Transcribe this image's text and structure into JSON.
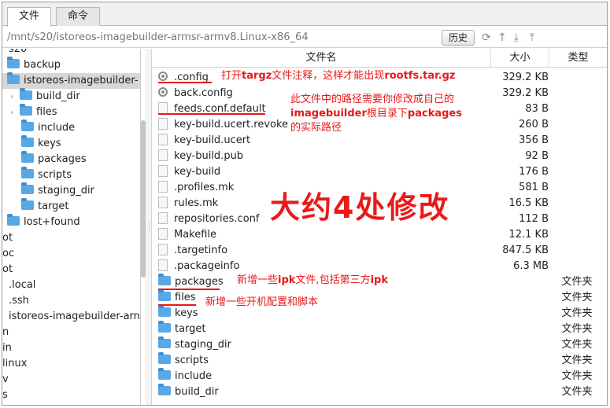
{
  "tabs": [
    {
      "label": "文件",
      "active": true
    },
    {
      "label": "命令",
      "active": false
    }
  ],
  "path": {
    "value": "/mnt/s20/istoreos-imagebuilder-armsr-armv8.Linux-x86_64",
    "history_label": "历史"
  },
  "toolbar_icons": [
    "refresh-icon",
    "up-icon",
    "download-icon",
    "upload-icon"
  ],
  "tree": [
    {
      "label": "s20",
      "kind": "text",
      "indent": 8,
      "cut": true
    },
    {
      "label": "backup",
      "kind": "folder",
      "indent": 6
    },
    {
      "label": "istoreos-imagebuilder-",
      "kind": "folder",
      "indent": 6,
      "selected": true
    },
    {
      "label": "build_dir",
      "kind": "folder",
      "indent": 10,
      "chevron": true
    },
    {
      "label": "files",
      "kind": "folder",
      "indent": 10,
      "chevron": true
    },
    {
      "label": "include",
      "kind": "folder",
      "indent": 24
    },
    {
      "label": "keys",
      "kind": "folder",
      "indent": 24
    },
    {
      "label": "packages",
      "kind": "folder",
      "indent": 24
    },
    {
      "label": "scripts",
      "kind": "folder",
      "indent": 24
    },
    {
      "label": "staging_dir",
      "kind": "folder",
      "indent": 24
    },
    {
      "label": "target",
      "kind": "folder",
      "indent": 24
    },
    {
      "label": "lost+found",
      "kind": "folder",
      "indent": 6
    },
    {
      "label": "ot",
      "kind": "text",
      "indent": 0
    },
    {
      "label": "oc",
      "kind": "text",
      "indent": 0
    },
    {
      "label": "ot",
      "kind": "text",
      "indent": 0
    },
    {
      "label": ".local",
      "kind": "text",
      "indent": 8
    },
    {
      "label": ".ssh",
      "kind": "text",
      "indent": 8
    },
    {
      "label": "istoreos-imagebuilder-arn",
      "kind": "text",
      "indent": 8
    },
    {
      "label": "n",
      "kind": "text",
      "indent": 0
    },
    {
      "label": "in",
      "kind": "text",
      "indent": 0
    },
    {
      "label": "linux",
      "kind": "text",
      "indent": 0
    },
    {
      "label": "v",
      "kind": "text",
      "indent": 0
    },
    {
      "label": "s",
      "kind": "text",
      "indent": 0
    }
  ],
  "columns": {
    "name": "文件名",
    "size": "大小",
    "type": "类型"
  },
  "files": [
    {
      "name": ".config",
      "size": "329.2 KB",
      "type": "",
      "icon": "gear"
    },
    {
      "name": "back.config",
      "size": "329.2 KB",
      "type": "",
      "icon": "gear"
    },
    {
      "name": "feeds.conf.default",
      "size": "83 B",
      "type": "",
      "icon": "doc"
    },
    {
      "name": "key-build.ucert.revoke",
      "size": "260 B",
      "type": "",
      "icon": "doc"
    },
    {
      "name": "key-build.ucert",
      "size": "356 B",
      "type": "",
      "icon": "doc"
    },
    {
      "name": "key-build.pub",
      "size": "92 B",
      "type": "",
      "icon": "doc"
    },
    {
      "name": "key-build",
      "size": "176 B",
      "type": "",
      "icon": "doc"
    },
    {
      "name": ".profiles.mk",
      "size": "581 B",
      "type": "",
      "icon": "doc"
    },
    {
      "name": "rules.mk",
      "size": "16.5 KB",
      "type": "",
      "icon": "doc"
    },
    {
      "name": "repositories.conf",
      "size": "112 B",
      "type": "",
      "icon": "doc"
    },
    {
      "name": "Makefile",
      "size": "12.1 KB",
      "type": "",
      "icon": "doc"
    },
    {
      "name": ".targetinfo",
      "size": "847.5 KB",
      "type": "",
      "icon": "doc"
    },
    {
      "name": ".packageinfo",
      "size": "6.3 MB",
      "type": "",
      "icon": "doc"
    },
    {
      "name": "packages",
      "size": "",
      "type": "文件夹",
      "icon": "folder"
    },
    {
      "name": "files",
      "size": "",
      "type": "文件夹",
      "icon": "folder"
    },
    {
      "name": "keys",
      "size": "",
      "type": "文件夹",
      "icon": "folder"
    },
    {
      "name": "target",
      "size": "",
      "type": "文件夹",
      "icon": "folder"
    },
    {
      "name": "staging_dir",
      "size": "",
      "type": "文件夹",
      "icon": "folder"
    },
    {
      "name": "scripts",
      "size": "",
      "type": "文件夹",
      "icon": "folder"
    },
    {
      "name": "include",
      "size": "",
      "type": "文件夹",
      "icon": "folder"
    },
    {
      "name": "build_dir",
      "size": "",
      "type": "文件夹",
      "icon": "folder"
    }
  ],
  "annotations": {
    "config_a": "打开",
    "config_b": "targz",
    "config_c": "文件注释，这样才能出现",
    "config_d": "rootfs.tar.gz",
    "feeds_line1": "此文件中的路径需要你修改成自己的",
    "feeds_line2a": "imagebuilder",
    "feeds_line2b": "根目录下",
    "feeds_line2c": "packages",
    "feeds_line3": "的实际路径",
    "big": "大约4处修改",
    "packages_a": "新增一些",
    "packages_b": "ipk",
    "packages_c": "文件,包括第三方",
    "packages_d": "ipk",
    "files": "新增一些开机配置和脚本",
    "color": "#e8191a"
  }
}
